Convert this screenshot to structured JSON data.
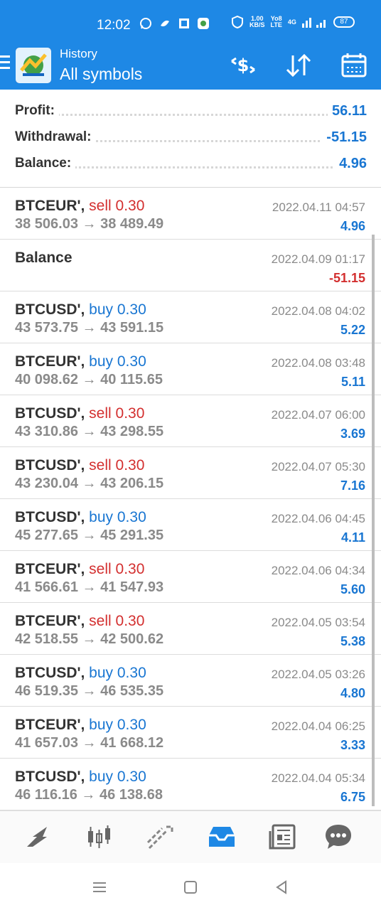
{
  "status_bar": {
    "time": "12:02",
    "net_speed_value": "1.00",
    "net_speed_unit": "KB/S",
    "volte": "Yo8",
    "lte": "LTE",
    "network": "4G",
    "battery": "87"
  },
  "app_bar": {
    "subtitle": "History",
    "title": "All symbols",
    "icons": [
      "menu-icon",
      "metatrader-logo",
      "currency-exchange-icon",
      "sort-icon",
      "calendar-icon"
    ]
  },
  "summary": {
    "profit_label": "Profit:",
    "profit_value": "56.11",
    "withdrawal_label": "Withdrawal:",
    "withdrawal_value": "-51.15",
    "balance_label": "Balance:",
    "balance_value": "4.96"
  },
  "rows": [
    {
      "symbol": "BTCEUR',",
      "side": "sell",
      "volume": "0.30",
      "prices": "38 506.03 → 38 489.49",
      "date": "2022.04.11 04:57",
      "profit": "4.96"
    },
    {
      "symbol": "Balance",
      "side": "",
      "volume": "",
      "prices": "",
      "date": "2022.04.09 01:17",
      "profit": "-51.15"
    },
    {
      "symbol": "BTCUSD',",
      "side": "buy",
      "volume": "0.30",
      "prices": "43 573.75 → 43 591.15",
      "date": "2022.04.08 04:02",
      "profit": "5.22"
    },
    {
      "symbol": "BTCEUR',",
      "side": "buy",
      "volume": "0.30",
      "prices": "40 098.62 → 40 115.65",
      "date": "2022.04.08 03:48",
      "profit": "5.11"
    },
    {
      "symbol": "BTCUSD',",
      "side": "sell",
      "volume": "0.30",
      "prices": "43 310.86 → 43 298.55",
      "date": "2022.04.07 06:00",
      "profit": "3.69"
    },
    {
      "symbol": "BTCUSD',",
      "side": "sell",
      "volume": "0.30",
      "prices": "43 230.04 → 43 206.15",
      "date": "2022.04.07 05:30",
      "profit": "7.16"
    },
    {
      "symbol": "BTCUSD',",
      "side": "buy",
      "volume": "0.30",
      "prices": "45 277.65 → 45 291.35",
      "date": "2022.04.06 04:45",
      "profit": "4.11"
    },
    {
      "symbol": "BTCEUR',",
      "side": "sell",
      "volume": "0.30",
      "prices": "41 566.61 → 41 547.93",
      "date": "2022.04.06 04:34",
      "profit": "5.60"
    },
    {
      "symbol": "BTCEUR',",
      "side": "sell",
      "volume": "0.30",
      "prices": "42 518.55 → 42 500.62",
      "date": "2022.04.05 03:54",
      "profit": "5.38"
    },
    {
      "symbol": "BTCUSD',",
      "side": "buy",
      "volume": "0.30",
      "prices": "46 519.35 → 46 535.35",
      "date": "2022.04.05 03:26",
      "profit": "4.80"
    },
    {
      "symbol": "BTCEUR',",
      "side": "buy",
      "volume": "0.30",
      "prices": "41 657.03 → 41 668.12",
      "date": "2022.04.04 06:25",
      "profit": "3.33"
    },
    {
      "symbol": "BTCUSD',",
      "side": "buy",
      "volume": "0.30",
      "prices": "46 116.16 → 46 138.68",
      "date": "2022.04.04 05:34",
      "profit": "6.75"
    }
  ],
  "bottom_nav": {
    "items": [
      "quotes-icon",
      "chart-icon",
      "trade-icon",
      "history-icon",
      "news-icon",
      "chat-icon"
    ],
    "active": "history-icon"
  },
  "colors": {
    "accent": "#1e88e5",
    "positive": "#1976d2",
    "negative": "#d32f2f",
    "muted": "#8a8a8a"
  }
}
